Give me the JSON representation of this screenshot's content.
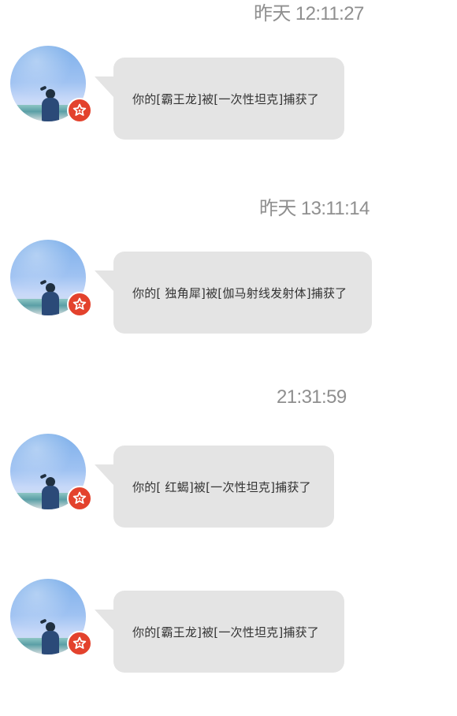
{
  "chat": {
    "timestamps": {
      "top_partial": "昨天 12:11:27",
      "second": "昨天 13:11:14",
      "third": "21:31:59"
    },
    "messages": [
      {
        "text": "你的[霸王龙]被[一次性坦克]捕获了"
      },
      {
        "text": "你的[ 独角犀]被[伽马射线发射体]捕获了"
      },
      {
        "text": "你的[ 红蝎]被[一次性坦克]捕获了"
      },
      {
        "text": "你的[霸王龙]被[一次性坦克]捕获了"
      }
    ]
  },
  "colors": {
    "bubble_bg": "#e4e4e4",
    "badge_bg": "#e3422d",
    "timestamp": "#8f8f8f",
    "text": "#333333"
  },
  "icons": {
    "avatar": "profile-photo-person-at-sea",
    "badge": "star-badge-icon"
  }
}
